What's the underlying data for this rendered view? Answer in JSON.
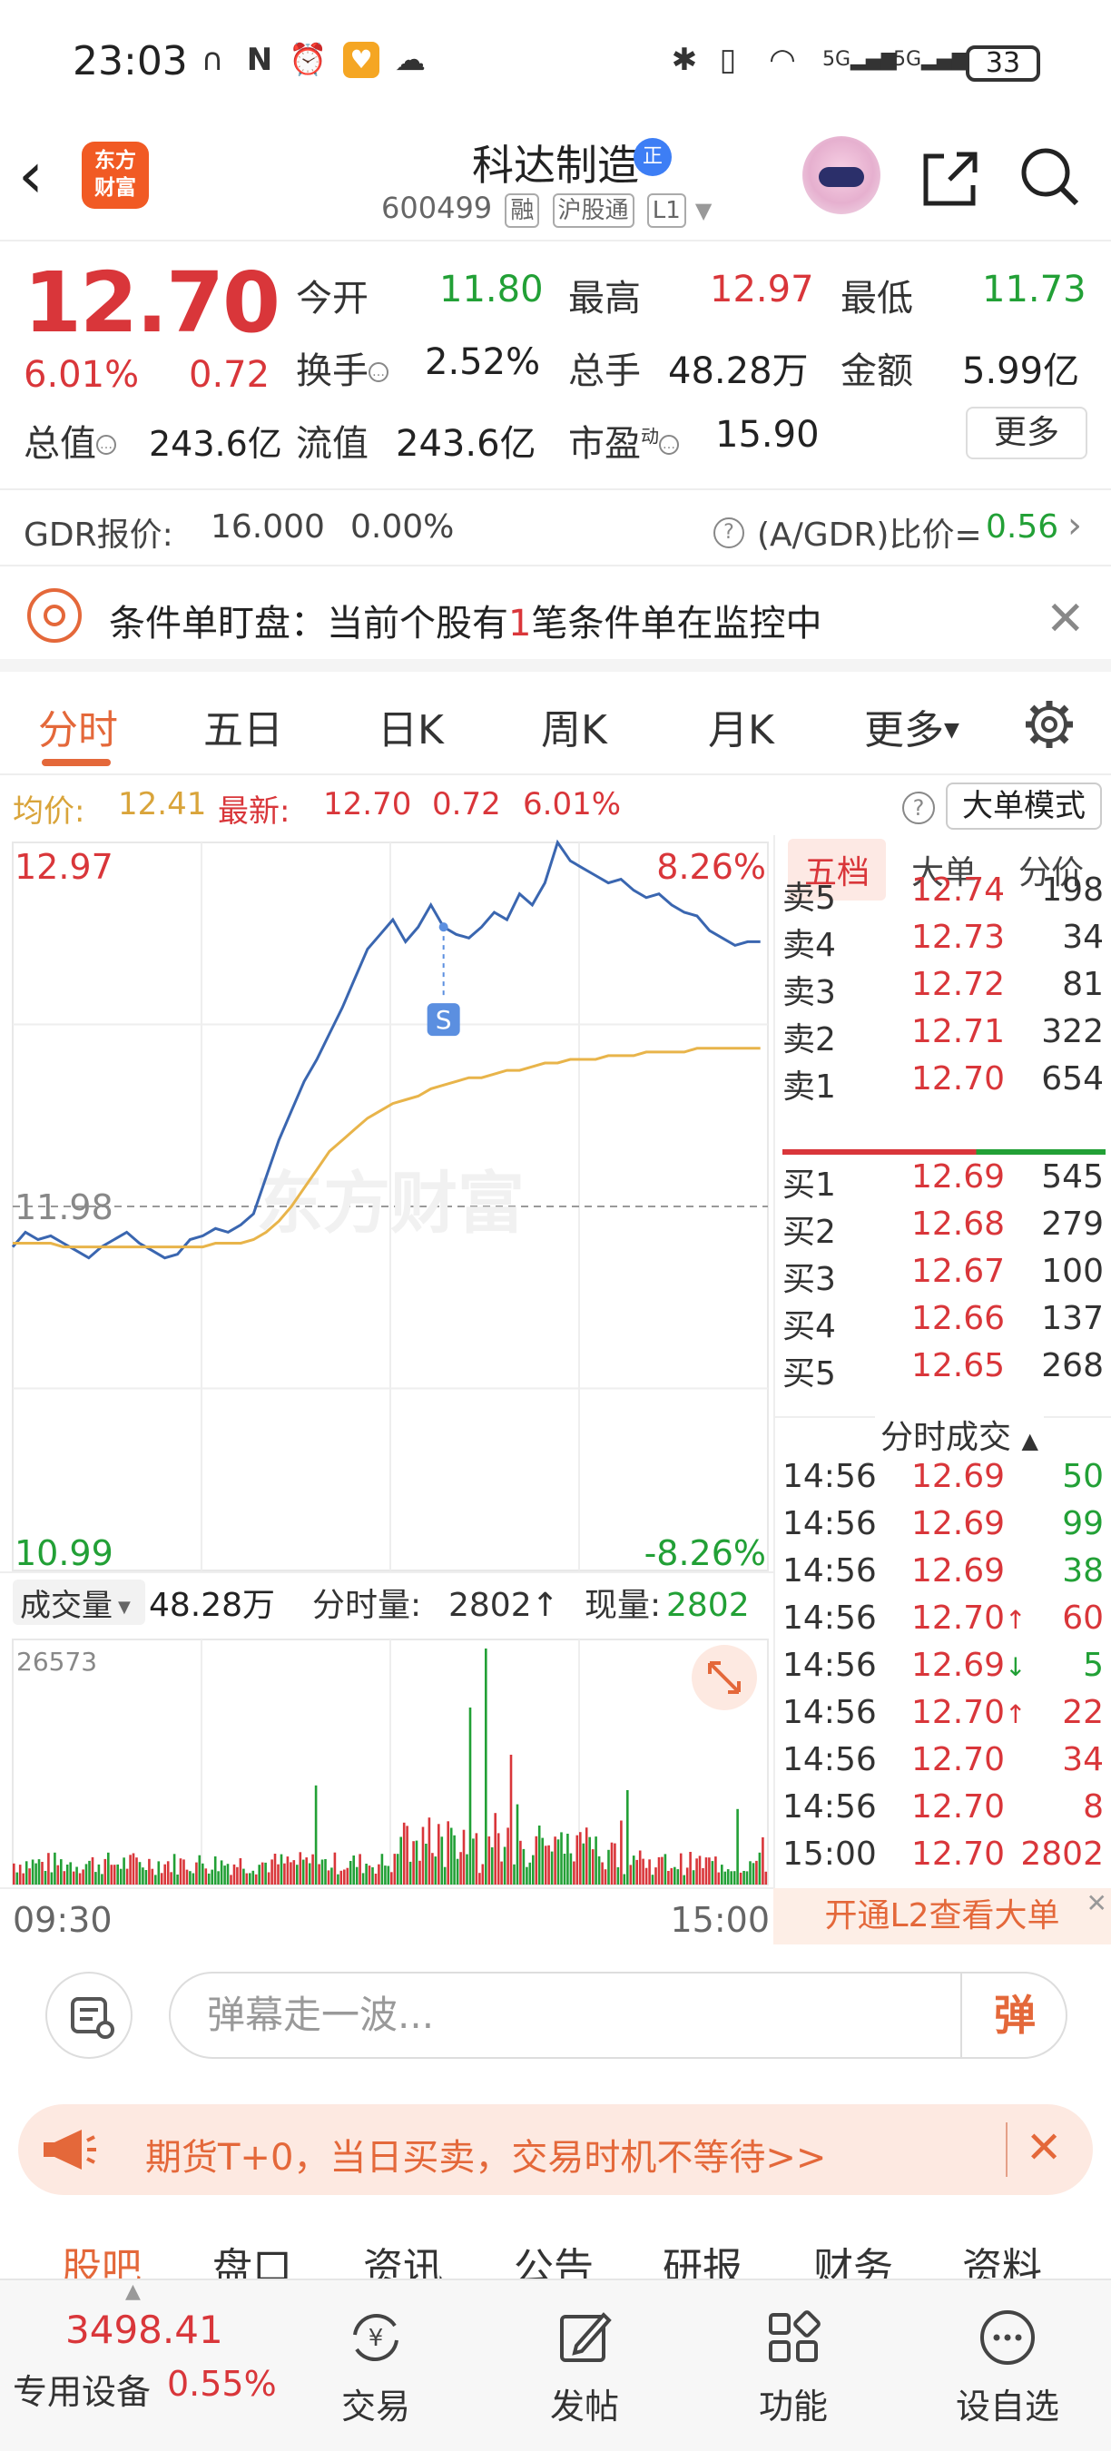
{
  "status_bar": {
    "time": "23:03",
    "battery": "33"
  },
  "header": {
    "logo_text": "东方\n财富",
    "stock_name": "科达制造",
    "name_badge": "正",
    "stock_code": "600499",
    "tags": [
      "融",
      "沪股通",
      "L1"
    ]
  },
  "quote": {
    "price": "12.70",
    "change_pct": "6.01%",
    "change_amt": "0.72",
    "open_label": "今开",
    "open_value": "11.80",
    "high_label": "最高",
    "high_value": "12.97",
    "low_label": "最低",
    "low_value": "11.73",
    "turnover_label": "换手",
    "turnover_value": "2.52%",
    "volume_label": "总手",
    "volume_value": "48.28万",
    "amount_label": "金额",
    "amount_value": "5.99亿",
    "mktcap_label": "总值",
    "mktcap_value": "243.6亿",
    "float_label": "流值",
    "float_value": "243.6亿",
    "pe_label": "市盈",
    "pe_sup": "动",
    "pe_value": "15.90",
    "more_label": "更多"
  },
  "gdr": {
    "label": "GDR报价:",
    "price": "16.000",
    "pct": "0.00%",
    "ratio_label": "(A/GDR)比价=",
    "ratio_value": "0.56"
  },
  "alert": {
    "text_prefix": "条件单盯盘：当前个股有",
    "count": "1",
    "text_suffix": "笔条件单在监控中"
  },
  "tabs": {
    "items": [
      "分时",
      "五日",
      "日K",
      "周K",
      "月K",
      "更多"
    ],
    "active": "分时"
  },
  "avg_row": {
    "avg_label": "均价:",
    "avg_value": "12.41",
    "latest_label": "最新:",
    "latest_price": "12.70",
    "latest_change": "0.72",
    "latest_pct": "6.01%",
    "bigorder_label": "大单模式"
  },
  "chart_data": {
    "type": "line",
    "y_top_label": "12.97",
    "y_mid_label": "11.98",
    "y_bottom_label": "10.99",
    "pct_top_label": "8.26%",
    "pct_bottom_label": "-8.26%",
    "ylim": [
      10.99,
      12.97
    ],
    "prev_close": 11.98,
    "x_start_label": "09:30",
    "x_end_label": "15:00",
    "marker_label": "S",
    "watermark": "东方财富",
    "series": [
      {
        "name": "最新",
        "color": "#3a66b0",
        "values": [
          11.87,
          11.91,
          11.89,
          11.9,
          11.88,
          11.86,
          11.84,
          11.87,
          11.89,
          11.91,
          11.88,
          11.86,
          11.84,
          11.85,
          11.89,
          11.9,
          11.92,
          11.91,
          11.93,
          11.96,
          12.06,
          12.16,
          12.24,
          12.32,
          12.38,
          12.45,
          12.52,
          12.6,
          12.68,
          12.72,
          12.76,
          12.7,
          12.74,
          12.8,
          12.74,
          12.72,
          12.71,
          12.74,
          12.78,
          12.76,
          12.83,
          12.8,
          12.86,
          12.97,
          12.92,
          12.9,
          12.88,
          12.86,
          12.87,
          12.84,
          12.82,
          12.83,
          12.8,
          12.78,
          12.77,
          12.73,
          12.71,
          12.69,
          12.7,
          12.7
        ]
      },
      {
        "name": "均价",
        "color": "#e8b44a",
        "values": [
          11.88,
          11.88,
          11.88,
          11.88,
          11.87,
          11.87,
          11.87,
          11.87,
          11.87,
          11.87,
          11.87,
          11.87,
          11.87,
          11.87,
          11.87,
          11.87,
          11.88,
          11.88,
          11.88,
          11.89,
          11.91,
          11.94,
          11.98,
          12.03,
          12.08,
          12.13,
          12.16,
          12.19,
          12.22,
          12.24,
          12.26,
          12.27,
          12.28,
          12.3,
          12.31,
          12.32,
          12.33,
          12.33,
          12.34,
          12.35,
          12.35,
          12.36,
          12.37,
          12.37,
          12.38,
          12.38,
          12.38,
          12.39,
          12.39,
          12.39,
          12.4,
          12.4,
          12.4,
          12.4,
          12.41,
          12.41,
          12.41,
          12.41,
          12.41,
          12.41
        ]
      }
    ],
    "volume": {
      "label": "成交量",
      "total": "48.28万",
      "minute_label": "分时量:",
      "minute_value": "2802",
      "current_label": "现量:",
      "current_value": "2802",
      "ymax_label": "26573",
      "ymax": 26573
    }
  },
  "orderbook": {
    "tabs": [
      "五档",
      "大单",
      "分价"
    ],
    "asks": [
      {
        "label": "卖5",
        "price": "12.74",
        "vol": "198"
      },
      {
        "label": "卖4",
        "price": "12.73",
        "vol": "34"
      },
      {
        "label": "卖3",
        "price": "12.72",
        "vol": "81"
      },
      {
        "label": "卖2",
        "price": "12.71",
        "vol": "322"
      },
      {
        "label": "卖1",
        "price": "12.70",
        "vol": "654"
      }
    ],
    "bids": [
      {
        "label": "买1",
        "price": "12.69",
        "vol": "545"
      },
      {
        "label": "买2",
        "price": "12.68",
        "vol": "279"
      },
      {
        "label": "买3",
        "price": "12.67",
        "vol": "100"
      },
      {
        "label": "买4",
        "price": "12.66",
        "vol": "137"
      },
      {
        "label": "买5",
        "price": "12.65",
        "vol": "268"
      }
    ],
    "trades_title": "分时成交",
    "trades": [
      {
        "time": "14:56",
        "price": "12.69",
        "arrow": "",
        "vol": "50",
        "dir": "sell"
      },
      {
        "time": "14:56",
        "price": "12.69",
        "arrow": "",
        "vol": "99",
        "dir": "sell"
      },
      {
        "time": "14:56",
        "price": "12.69",
        "arrow": "",
        "vol": "38",
        "dir": "sell"
      },
      {
        "time": "14:56",
        "price": "12.70",
        "arrow": "↑",
        "vol": "60",
        "dir": "buy"
      },
      {
        "time": "14:56",
        "price": "12.69",
        "arrow": "↓",
        "vol": "5",
        "dir": "sell"
      },
      {
        "time": "14:56",
        "price": "12.70",
        "arrow": "↑",
        "vol": "22",
        "dir": "buy"
      },
      {
        "time": "14:56",
        "price": "12.70",
        "arrow": "",
        "vol": "34",
        "dir": "buy"
      },
      {
        "time": "14:56",
        "price": "12.70",
        "arrow": "",
        "vol": "8",
        "dir": "buy"
      },
      {
        "time": "15:00",
        "price": "12.70",
        "arrow": "",
        "vol": "2802",
        "dir": "buy"
      }
    ],
    "l2_banner": "开通L2查看大单"
  },
  "danmu": {
    "placeholder": "弹幕走一波...",
    "button": "弹"
  },
  "ad": {
    "text": "期货T+0，当日买卖，交易时机不等待>>"
  },
  "subtabs": [
    "股吧",
    "盘口",
    "资讯",
    "公告",
    "研报",
    "财务",
    "资料"
  ],
  "bottom_nav": {
    "index_value": "3498.41",
    "sector_label": "专用设备",
    "sector_pct": "0.55%",
    "items": [
      "交易",
      "发帖",
      "功能",
      "设自选"
    ]
  }
}
